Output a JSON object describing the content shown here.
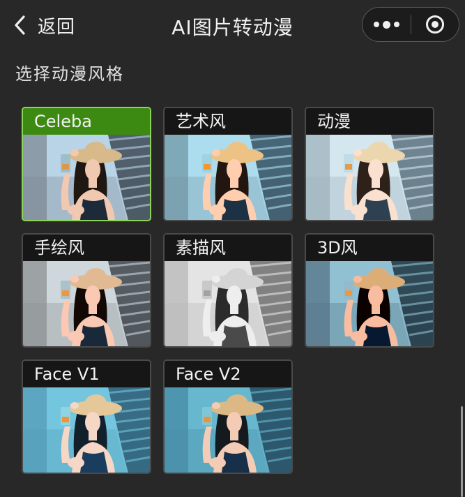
{
  "header": {
    "back_label": "返回",
    "title": "AI图片转动漫"
  },
  "section": {
    "label": "选择动漫风格"
  },
  "styles": [
    {
      "label": "Celeba",
      "selected": true,
      "palette": "natural"
    },
    {
      "label": "艺术风",
      "selected": false,
      "palette": "artistic"
    },
    {
      "label": "动漫",
      "selected": false,
      "palette": "anime"
    },
    {
      "label": "手绘风",
      "selected": false,
      "palette": "handdrawn"
    },
    {
      "label": "素描风",
      "selected": false,
      "palette": "sketch"
    },
    {
      "label": "3D风",
      "selected": false,
      "palette": "render3d"
    },
    {
      "label": "Face V1",
      "selected": false,
      "palette": "facev1"
    },
    {
      "label": "Face V2",
      "selected": false,
      "palette": "facev2"
    }
  ],
  "colors": {
    "background": "#282828",
    "selected_accent": "#3d8a12",
    "selected_border": "#8bd35a"
  }
}
